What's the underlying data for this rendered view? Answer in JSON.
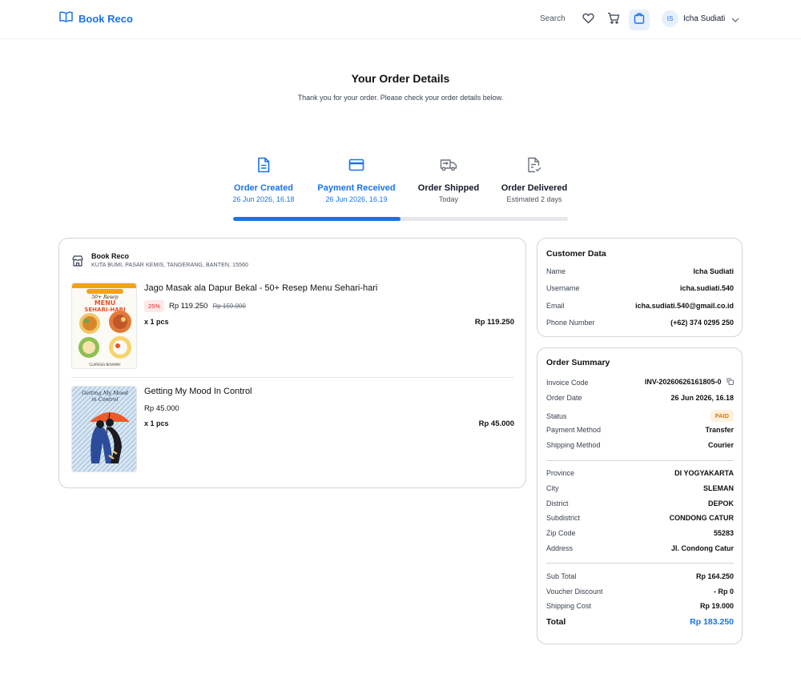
{
  "header": {
    "brand": "Book Reco",
    "search_label": "Search",
    "user": {
      "initials": "IS",
      "name": "Icha Sudiati"
    }
  },
  "page": {
    "title": "Your Order Details",
    "subtitle": "Thank you for your order. Please check your order details below."
  },
  "steps": [
    {
      "label": "Order Created",
      "date": "26 Jun 2026, 16.18",
      "status": "done",
      "icon": "document-icon"
    },
    {
      "label": "Payment Received",
      "date": "26 Jun 2026, 16.19",
      "status": "done",
      "icon": "credit-card-icon"
    },
    {
      "label": "Order Shipped",
      "date": "Today",
      "status": "todo",
      "icon": "truck-icon"
    },
    {
      "label": "Order Delivered",
      "date": "Estimated 2 days",
      "status": "todo",
      "icon": "document-check-icon"
    }
  ],
  "progress": {
    "fraction": 0.5
  },
  "store": {
    "name": "Book Reco",
    "address": "KUTA BUMI, PASAR KEMIS, TANGERANG, BANTEN, 15560"
  },
  "items": [
    {
      "title": "Jago Masak ala Dapur Bekal - 50+ Resep Menu Sehari-hari",
      "discount": "25%",
      "price": "Rp 119.250",
      "original_price": "Rp 159.000",
      "qty": "x 1 pcs",
      "total": "Rp 119.250",
      "cover_text": [
        "50+ Resep",
        "MENU",
        "SEHARI-HARI",
        "CLARISSA NOVIANY"
      ]
    },
    {
      "title": "Getting My Mood In Control",
      "price": "Rp 45.000",
      "qty": "x 1 pcs",
      "total": "Rp 45.000",
      "cover_text": [
        "Getting My Mood",
        "in Control"
      ]
    }
  ],
  "customer": {
    "title": "Customer Data",
    "rows": [
      {
        "k": "Name",
        "v": "Icha Sudiati"
      },
      {
        "k": "Username",
        "v": "icha.sudiati.540"
      },
      {
        "k": "Email",
        "v": "icha.sudiati.540@gmail.co.id"
      },
      {
        "k": "Phone Number",
        "v": "(+62) 374 0295 250"
      }
    ]
  },
  "summary": {
    "title": "Order Summary",
    "invoice": {
      "k": "Invoice Code",
      "v": "INV-20260626161805-0"
    },
    "order_date": {
      "k": "Order Date",
      "v": "26 Jun 2026, 16.18"
    },
    "status": {
      "k": "Status",
      "v": "PAID"
    },
    "payment_method": {
      "k": "Payment Method",
      "v": "Transfer"
    },
    "shipping_method": {
      "k": "Shipping Method",
      "v": "Courier"
    },
    "address": [
      {
        "k": "Province",
        "v": "DI YOGYAKARTA"
      },
      {
        "k": "City",
        "v": "SLEMAN"
      },
      {
        "k": "District",
        "v": "DEPOK"
      },
      {
        "k": "Subdistrict",
        "v": "CONDONG CATUR"
      },
      {
        "k": "Zip Code",
        "v": "55283"
      },
      {
        "k": "Address",
        "v": "Jl. Condong Catur"
      }
    ],
    "costs": [
      {
        "k": "Sub Total",
        "v": "Rp 164.250"
      },
      {
        "k": "Voucher Discount",
        "v": "- Rp 0"
      },
      {
        "k": "Shipping Cost",
        "v": "Rp 19.000"
      }
    ],
    "total": {
      "k": "Total",
      "v": "Rp 183.250"
    }
  },
  "colors": {
    "accent": "#1a73e8",
    "border": "#d1d5db",
    "paid_bg": "#fff1dc",
    "paid_fg": "#d97706",
    "discount_bg": "#fde8e8",
    "discount_fg": "#dc2626"
  }
}
